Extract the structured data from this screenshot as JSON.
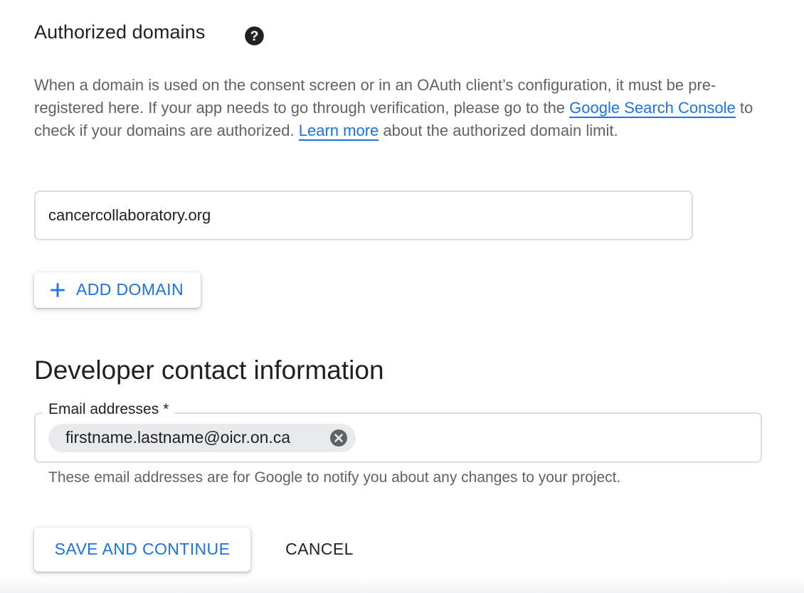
{
  "authorized_domains": {
    "title": "Authorized domains",
    "help_icon": "help-circle-icon",
    "description_part1": "When a domain is used on the consent screen or in an OAuth client’s configuration, it must be pre-registered here. If your app needs to go through verification, please go to the ",
    "link_search_console": "Google Search Console",
    "description_part2": " to check if your domains are authorized. ",
    "link_learn_more": "Learn more",
    "description_part3": " about the authorized domain limit.",
    "domains": [
      "cancercollaboratory.org"
    ],
    "add_domain_label": "ADD DOMAIN",
    "add_icon": "plus-icon"
  },
  "developer_contact": {
    "title": "Developer contact information",
    "email_label": "Email addresses *",
    "emails": [
      "firstname.lastname@oicr.on.ca"
    ],
    "remove_icon": "cancel-icon",
    "hint": "These email addresses are for Google to notify you about any changes to your project."
  },
  "actions": {
    "save_label": "SAVE AND CONTINUE",
    "cancel_label": "CANCEL"
  },
  "colors": {
    "accent": "#1a73e8",
    "text_primary": "#202124",
    "text_secondary": "#5f6368",
    "border": "#dadce0",
    "chip_bg": "#e8eaed"
  }
}
